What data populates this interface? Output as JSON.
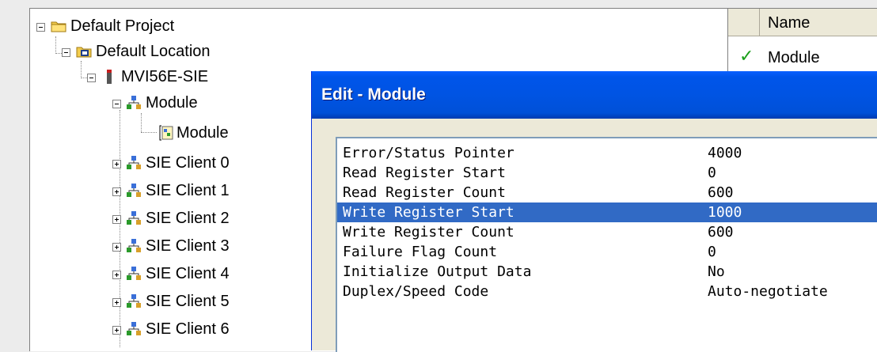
{
  "tree": {
    "items": [
      {
        "label": "Default Project",
        "icon": "folder-icon"
      },
      {
        "label": "Default Location",
        "icon": "location-icon"
      },
      {
        "label": "MVI56E-SIE",
        "icon": "module-card-icon"
      },
      {
        "label": "Module",
        "icon": "network-icon"
      },
      {
        "label": "Module",
        "icon": "config-page-icon"
      },
      {
        "label": "SIE Client 0",
        "icon": "network-icon"
      },
      {
        "label": "SIE Client 1",
        "icon": "network-icon"
      },
      {
        "label": "SIE Client 2",
        "icon": "network-icon"
      },
      {
        "label": "SIE Client 3",
        "icon": "network-icon"
      },
      {
        "label": "SIE Client 4",
        "icon": "network-icon"
      },
      {
        "label": "SIE Client 5",
        "icon": "network-icon"
      },
      {
        "label": "SIE Client 6",
        "icon": "network-icon"
      }
    ]
  },
  "list": {
    "header": "Name",
    "rows": [
      {
        "status_icon": "checkmark-icon",
        "name": "Module"
      }
    ]
  },
  "dialog": {
    "title": "Edit - Module",
    "properties": [
      {
        "name": "Error/Status Pointer",
        "value": "4000"
      },
      {
        "name": "Read Register Start",
        "value": "0"
      },
      {
        "name": "Read Register Count",
        "value": "600"
      },
      {
        "name": "Write Register Start",
        "value": "1000",
        "selected": true
      },
      {
        "name": "Write Register Count",
        "value": "600"
      },
      {
        "name": "Failure Flag Count",
        "value": "0"
      },
      {
        "name": "Initialize Output Data",
        "value": "No"
      },
      {
        "name": "Duplex/Speed Code",
        "value": "Auto-negotiate"
      }
    ]
  },
  "colors": {
    "selection": "#316ac5",
    "titlebar": "#0054e3",
    "dialog_bg": "#ece9d8"
  }
}
